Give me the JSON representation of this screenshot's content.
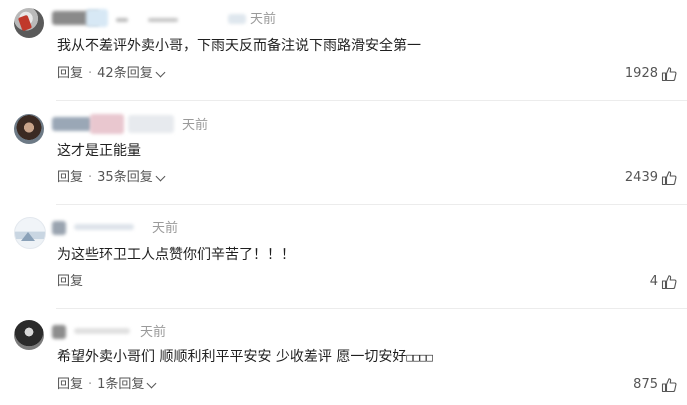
{
  "comments": [
    {
      "time": "天前",
      "text": "我从不差评外卖小哥，下雨天反而备注说下雨路滑安全第一",
      "reply_label": "回复",
      "separator": "·",
      "reply_count": "42条回复",
      "likes": "1928"
    },
    {
      "time": "天前",
      "text": "这才是正能量",
      "reply_label": "回复",
      "separator": "·",
      "reply_count": "35条回复",
      "likes": "2439"
    },
    {
      "time": "天前",
      "text": "为这些环卫工人点赞你们辛苦了！！！",
      "reply_label": "回复",
      "likes": "4"
    },
    {
      "time": "天前",
      "text": "希望外卖小哥们 顺顺利利平平安安 少收差评 愿一切安好",
      "text_tail": "□□□□",
      "reply_label": "回复",
      "separator": "·",
      "reply_count": "1条回复",
      "likes": "875"
    }
  ],
  "icons": {
    "like": "thumbs-up-icon",
    "expand": "chevron-down-icon"
  },
  "colors": {
    "time": "#9a9a9a",
    "meta": "#555555",
    "text": "#1f1f1f",
    "divider": "#ececec"
  }
}
